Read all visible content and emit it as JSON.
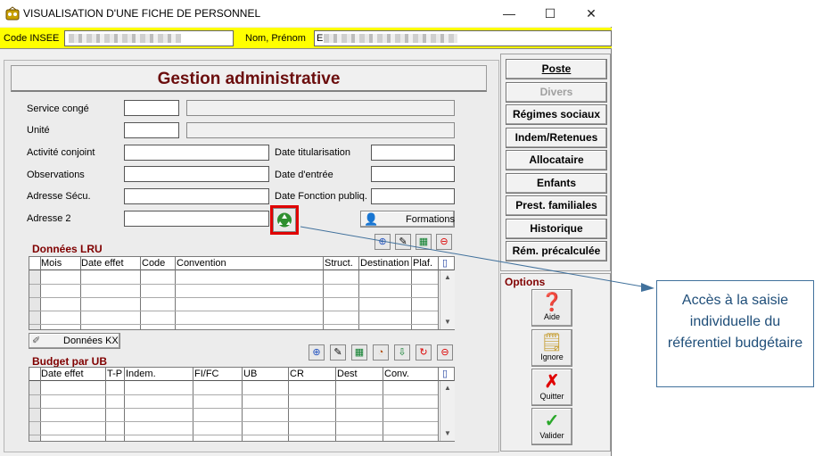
{
  "window": {
    "title": "VISUALISATION D'UNE FICHE DE PERSONNEL",
    "minimize": "—",
    "maximize": "☐",
    "close": "✕"
  },
  "idbar": {
    "code_label": "Code INSEE",
    "name_label": "Nom, Prénom",
    "name_first_char": "E"
  },
  "header": {
    "title": "Gestion administrative"
  },
  "form": {
    "service_conge": "Service congé",
    "unite": "Unité",
    "activite_conjoint": "Activité conjoint",
    "observations": "Observations",
    "adresse_secu": "Adresse Sécu.",
    "adresse_2": "Adresse 2",
    "date_titularisation": "Date titularisation",
    "date_entree": "Date d'entrée",
    "date_fonction_publiq": "Date Fonction publiq.",
    "formations_button": "Formations"
  },
  "lru": {
    "title": "Données LRU",
    "columns": [
      "Mois",
      "Date effet",
      "Code",
      "Convention",
      "Struct.",
      "Destination",
      "Plaf."
    ]
  },
  "kx_button": "Données KX",
  "budget": {
    "title": "Budget par UB",
    "columns": [
      "Date effet",
      "T-P",
      "Indem.",
      "FI/FC",
      "UB",
      "CR",
      "Dest",
      "Conv."
    ]
  },
  "right_buttons": {
    "poste": "Poste",
    "divers": "Divers",
    "regimes": "Régimes sociaux",
    "indem": "Indem/Retenues",
    "allocataire": "Allocataire",
    "enfants": "Enfants",
    "prest": "Prest. familiales",
    "historique": "Historique",
    "rem": "Rém. précalculée"
  },
  "options": {
    "title": "Options",
    "aide": "Aide",
    "ignore": "Ignore",
    "quitter": "Quitter",
    "valider": "Valider"
  },
  "callout": {
    "text": "Accès à la saisie individuelle du référentiel budgétaire"
  },
  "colors": {
    "header_text": "#6b0d0d",
    "section_text": "#800000",
    "idbar": "#ffff00",
    "highlight": "#e00000",
    "callout_border": "#41719c",
    "callout_text": "#1f4e79"
  }
}
